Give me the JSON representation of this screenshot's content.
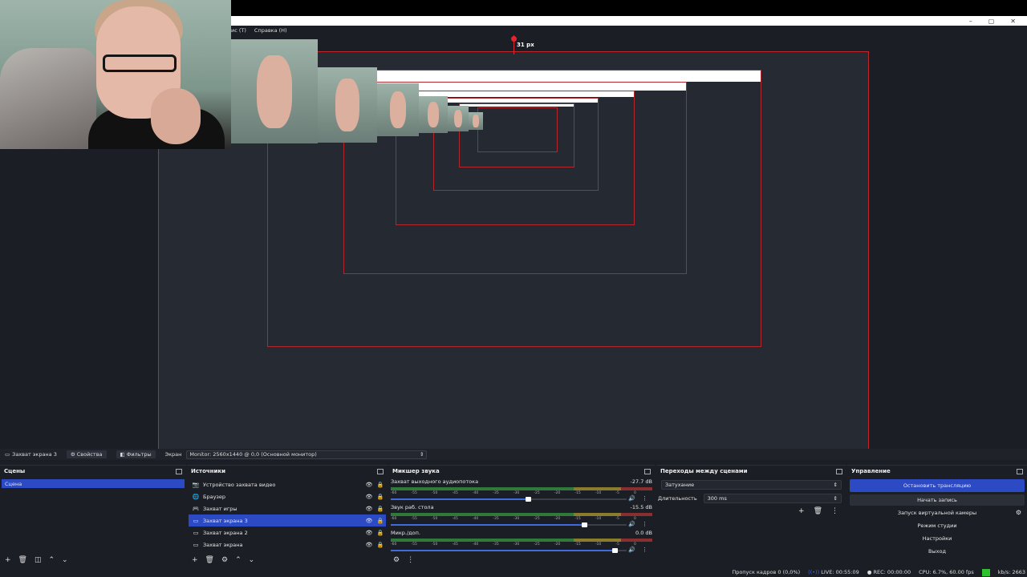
{
  "menu": {
    "tools_partial": "ис (T)",
    "help": "Справка (H)"
  },
  "guide_label": "31 px",
  "window_buttons": [
    "–",
    "▢",
    "✕"
  ],
  "scenebar": {
    "source_name": "Захват экрана 3",
    "properties": "Свойства",
    "filters": "Фильтры",
    "screen_label": "Экран",
    "monitor": "Monitor: 2560x1440 @ 0,0 (Основной монитор)"
  },
  "scenes": {
    "title": "Сцены",
    "items": [
      "Сцена"
    ]
  },
  "sources": {
    "title": "Источники",
    "items": [
      {
        "label": "Устройство захвата видео",
        "icon": "camera-icon",
        "glyph": "📷"
      },
      {
        "label": "Браузер",
        "icon": "globe-icon",
        "glyph": "🌐"
      },
      {
        "label": "Захват игры",
        "icon": "gamepad-icon",
        "glyph": "🎮"
      },
      {
        "label": "Захват экрана 3",
        "icon": "monitor-icon",
        "glyph": "▭",
        "selected": true
      },
      {
        "label": "Захват экрана 2",
        "icon": "monitor-icon",
        "glyph": "▭"
      },
      {
        "label": "Захват экрана",
        "icon": "monitor-icon",
        "glyph": "▭"
      }
    ]
  },
  "mixer": {
    "title": "Микшер звука",
    "ticks": [
      "-60",
      "-55",
      "-50",
      "-45",
      "-40",
      "-35",
      "-30",
      "-25",
      "-20",
      "-15",
      "-10",
      "-5",
      "0"
    ],
    "channels": [
      {
        "name": "Захват выходного аудиопотока",
        "db": "-27.7 dB",
        "level": 0.58
      },
      {
        "name": "Звук раб. стола",
        "db": "-15.5 dB",
        "level": 0.82
      },
      {
        "name": "Микр./доп.",
        "db": "0.0 dB",
        "level": 0.95
      }
    ]
  },
  "transitions": {
    "title": "Переходы между сценами",
    "selected": "Затухание",
    "duration_label": "Длительность",
    "duration_value": "300 ms"
  },
  "controls": {
    "title": "Управление",
    "stop_stream": "Остановить трансляцию",
    "start_record": "Начать запись",
    "virtual_cam": "Запуск виртуальной камеры",
    "studio_mode": "Режим студии",
    "settings": "Настройки",
    "exit": "Выход"
  },
  "status": {
    "dropped": "Пропуск кадров 0 (0,0%)",
    "live": "LIVE: 00:55:09",
    "rec": "REC: 00:00:00",
    "cpu": "CPU: 6.7%, 60.00 fps",
    "kbps": "kb/s: 2663"
  },
  "colors": {
    "accent": "#2c4ac4",
    "guide": "#e0262e",
    "live_ok": "#2ec22e"
  }
}
